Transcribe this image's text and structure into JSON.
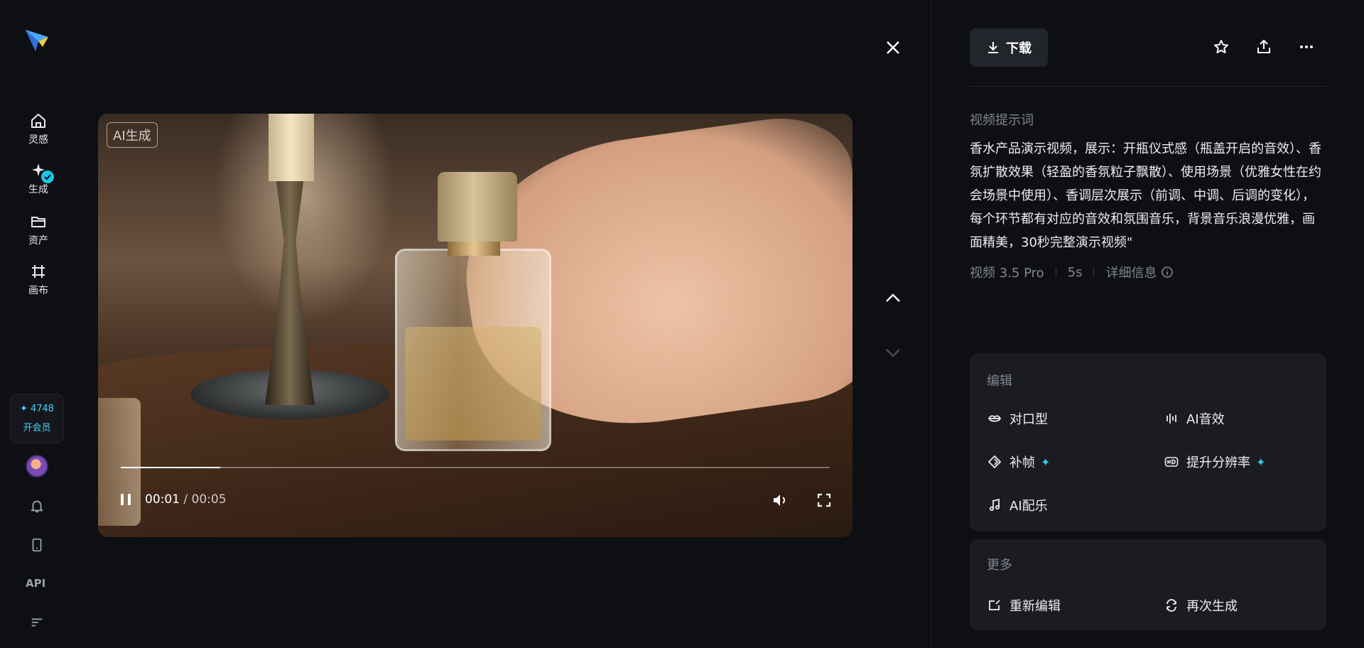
{
  "sidebar": {
    "items": [
      {
        "label": "灵感",
        "icon": "home-icon"
      },
      {
        "label": "生成",
        "icon": "generate-icon"
      },
      {
        "label": "资产",
        "icon": "folder-icon"
      },
      {
        "label": "画布",
        "icon": "canvas-icon"
      }
    ],
    "credits": {
      "value": "4748",
      "vip_label": "开会员"
    },
    "api_label": "API"
  },
  "video": {
    "ai_tag": "AI生成",
    "current_time": "00:01",
    "total_time": "/ 00:05",
    "progress": 0.14
  },
  "toolbar": {
    "download_label": "下载"
  },
  "prompt": {
    "title": "视频提示词",
    "text": "香水产品演示视频，展示：开瓶仪式感（瓶盖开启的音效）、香氛扩散效果（轻盈的香氛粒子飘散）、使用场景（优雅女性在约会场景中使用）、香调层次展示（前调、中调、后调的变化），每个环节都有对应的音效和氛围音乐，背景音乐浪漫优雅，画面精美，30秒完整演示视频\"",
    "model": "视频 3.5 Pro",
    "duration": "5s",
    "details": "详细信息"
  },
  "edit_card": {
    "title": "编辑",
    "options": [
      {
        "label": "对口型",
        "icon": "lips-icon"
      },
      {
        "label": "AI音效",
        "icon": "sound-effect-icon"
      },
      {
        "label": "补帧",
        "icon": "frame-interpolation-icon"
      },
      {
        "label": "提升分辨率",
        "icon": "hd-icon"
      },
      {
        "label": "AI配乐",
        "icon": "music-note-icon"
      }
    ],
    "spark": "✦"
  },
  "more_card": {
    "title": "更多",
    "options": [
      {
        "label": "重新编辑",
        "icon": "re-edit-icon"
      },
      {
        "label": "再次生成",
        "icon": "regenerate-icon"
      }
    ]
  },
  "colors": {
    "accent": "#2ad0f0",
    "background": "#0e0f13",
    "card": "#1b1c22"
  }
}
